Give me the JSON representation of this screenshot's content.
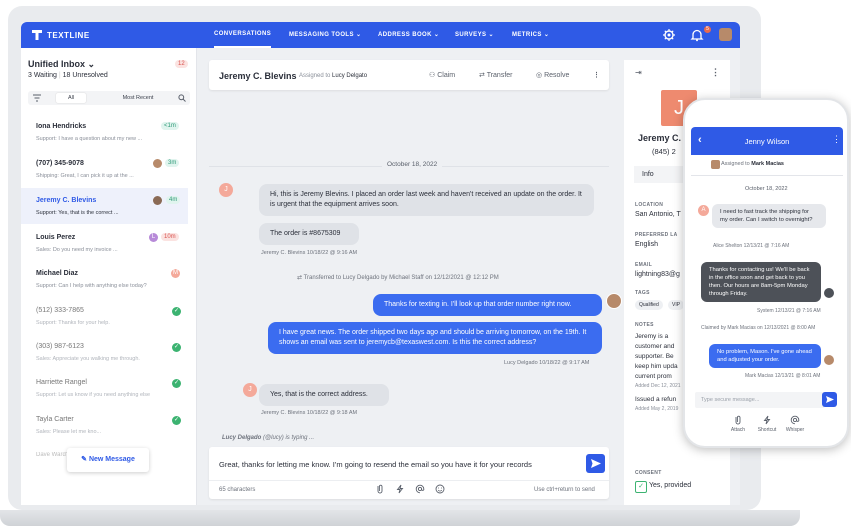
{
  "app": {
    "logo_text": "TEXTLINE"
  },
  "nav": {
    "items": [
      "CONVERSATIONS",
      "MESSAGING TOOLS",
      "ADDRESS BOOK",
      "SURVEYS",
      "METRICS"
    ],
    "notification_count": "5"
  },
  "sidebar": {
    "inbox_title": "Unified Inbox",
    "inbox_badge": "12",
    "waiting": "3 Waiting",
    "unresolved": "18 Unresolved",
    "filter_all": "All",
    "filter_recent": "Most Recent",
    "conversations": [
      {
        "name": "Iona Hendricks",
        "preview": "Support: I have a question about my new ...",
        "time": "<1m"
      },
      {
        "name": "(707) 345-9078",
        "preview": "Shipping: Great, I can pick it up at the ...",
        "time": "3m"
      },
      {
        "name": "Jeremy C. Blevins",
        "preview": "Support: Yes, that is the correct ...",
        "time": "4m"
      },
      {
        "name": "Louis Perez",
        "preview": "Sales: Do you need my invoice ...",
        "time": "10m",
        "agent_initial": "L"
      },
      {
        "name": "Michael Diaz",
        "preview": "Support: Can I help with anything else today?",
        "agent_initial": "M"
      },
      {
        "name": "(512) 333-7865",
        "preview": "Support: Thanks for your help."
      },
      {
        "name": "(303) 987-6123",
        "preview": "Sales: Appreciate you walking me through."
      },
      {
        "name": "Harriette Rangel",
        "preview": "Support: Let us know if you need anything else"
      },
      {
        "name": "Tayla Carter",
        "preview": "Sales: Please let me kno..."
      },
      {
        "name": "Dave Ward's Liquidation Sales",
        "preview": ""
      }
    ],
    "new_message": "New Message"
  },
  "chat": {
    "contact_name": "Jeremy C. Blevins",
    "assigned_prefix": "Assigned to",
    "assigned_to": "Lucy Delgato",
    "actions": {
      "claim": "Claim",
      "transfer": "Transfer",
      "resolve": "Resolve"
    },
    "date": "October 18, 2022",
    "customer_initial": "J",
    "messages": [
      {
        "text": "Hi, this is Jeremy Blevins. I placed an order last week and haven't received an update on the order. It is urgent that the equipment arrives soon.",
        "direction": "in"
      },
      {
        "text": "The order is #8675309",
        "direction": "in"
      },
      {
        "meta": "Jeremy C. Blevins   10/18/22 @ 9:16 AM"
      },
      {
        "event": "Transferred to Lucy Delgado by Michael Staff on 12/12/2021 @ 12:12 PM"
      },
      {
        "text": "Thanks for texting in. I'll look up that order number right now.",
        "direction": "out"
      },
      {
        "text": "I have great news. The order shipped two days ago and should be arriving tomorrow, on the 19th. It shows an email was sent to jeremycb@texaswest.com. Is this the correct address?",
        "direction": "out"
      },
      {
        "meta": "Lucy Delgado   10/18/22 @ 9:17 AM"
      },
      {
        "text": "Yes, that is the correct address.",
        "direction": "in"
      },
      {
        "meta": "Jeremy C. Blevins   10/18/22 @ 9:18 AM"
      }
    ],
    "typing_name": "Lucy Delgado",
    "typing_handle": "(@lucy)",
    "typing_suffix": "is typing ...",
    "composer_text": "Great, thanks for letting me know. I'm going to resend the email so you have it for your records",
    "char_count": "65 characters",
    "send_hint": "Use ctrl+return to send"
  },
  "details": {
    "initial": "J",
    "name": "Jeremy C.",
    "phone": "(845) 2",
    "tab": "Info",
    "location_label": "LOCATION",
    "location": "San Antonio, T",
    "language_label": "PREFERRED LA",
    "language": "English",
    "email_label": "EMAIL",
    "email": "lightning83@g",
    "tags_label": "TAGS",
    "tags": [
      "Qualified",
      "VIP"
    ],
    "notes_label": "NOTES",
    "notes": [
      "Jeremy is a",
      "customer and",
      "supporter. Be",
      "keep him upda",
      "current prom"
    ],
    "notes_date_1": "Added Dec 12, 2021",
    "notes_2": "Issued a refun",
    "notes_date_2": "Added May 2, 2019",
    "consent_label": "CONSENT",
    "consent": "Yes, provided"
  },
  "phone": {
    "title": "Jenny Wilson",
    "assigned_prefix": "Assigned to",
    "assigned_to": "Mark Macias",
    "date": "October 18, 2022",
    "customer_initial": "A",
    "messages": [
      {
        "text": "I need to fast track the shipping for my order. Can I switch to overnight?",
        "meta": "Alice Shelton   12/13/21 @ 7:16 AM"
      },
      {
        "text": "Thanks for contacting us! We'll be back in the office soon and get back to you then. Our hours are 8am-5pm Monday through Friday.",
        "meta": "System   12/13/21 @ 7:16 AM"
      },
      {
        "event": "Claimed by Mark Macias on 12/13/2021 @ 8:00 AM"
      },
      {
        "text": "No problem, Mason. I've gone ahead and adjusted your order.",
        "meta": "Mark Macias   12/13/21 @ 8:01 AM"
      }
    ],
    "input_placeholder": "Type secure message...",
    "tools": [
      "Attach",
      "Shortcut",
      "Whisper"
    ]
  },
  "colors": {
    "brand": "#2f5ae6",
    "outgoing": "#3b6cf0",
    "incoming": "#dfe2e7",
    "success": "#3cb371",
    "avatar": "#ee8a6f"
  }
}
